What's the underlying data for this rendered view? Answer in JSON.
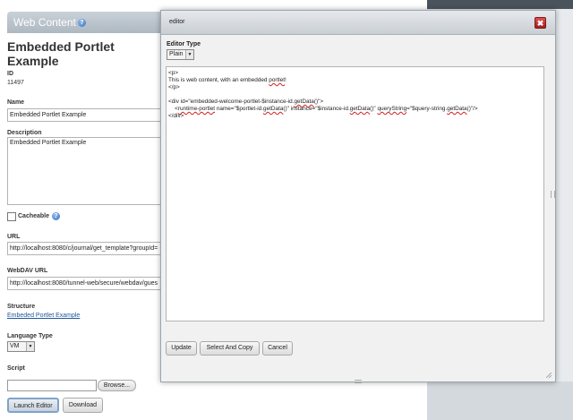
{
  "portlet": {
    "title": "Web Content",
    "page_title": "Embedded Portlet Example",
    "id_label": "ID",
    "id_value": "11497",
    "name_label": "Name",
    "name_value": "Embedded Portlet Example",
    "description_label": "Description",
    "description_value": "Embedded Portlet Example",
    "cacheable_label": "Cacheable",
    "url_label": "URL",
    "url_value": "http://localhost:8080/c/journal/get_template?groupId=",
    "webdav_label": "WebDAV URL",
    "webdav_value": "http://localhost:8080/tunnel-web/secure/webdav/gues",
    "structure_label": "Structure",
    "structure_link": "Embeded Portlet Example",
    "language_label": "Language Type",
    "language_value": "VM",
    "script_label": "Script",
    "browse_label": "Browse...",
    "launch_editor_label": "Launch Editor",
    "download_label": "Download"
  },
  "dialog": {
    "title": "editor",
    "close_glyph": "✖",
    "editor_type_label": "Editor Type",
    "editor_type_value": "Plain",
    "code_lines": [
      "<p>",
      "This is web content, with an embedded portlet!",
      "</p>",
      "",
      "<div id=\"embedded-welcome-portlet-$instance-id.getData()\">",
      "    <runtime-portlet name=\"$portlet-id.getData()\" instance=\"$instance-id.getData()\" queryString=\"$query-string.getData()\"/>",
      "</div>"
    ],
    "update_label": "Update",
    "select_copy_label": "Select And Copy",
    "cancel_label": "Cancel"
  },
  "icons": {
    "help": "help-icon",
    "close": "close-icon",
    "dropdown": "chevron-down-icon"
  },
  "colors": {
    "header": "#aeb8c1",
    "link": "#22589a",
    "close": "#c02a2a"
  }
}
